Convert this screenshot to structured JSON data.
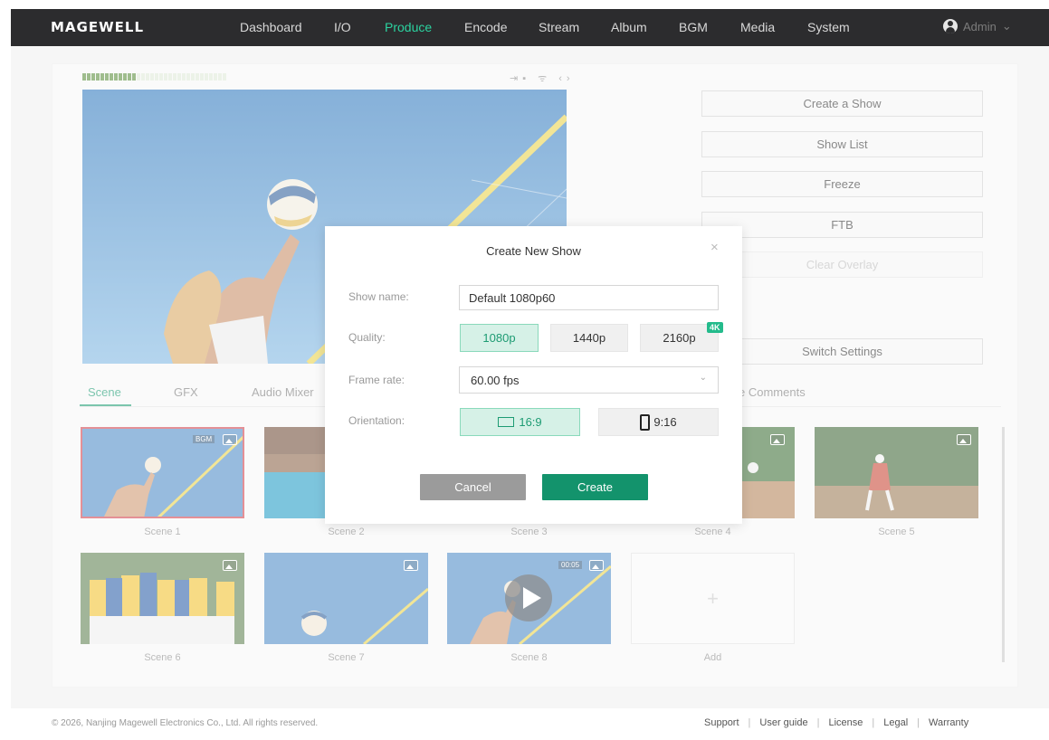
{
  "app": {
    "logo": "MAGEWELL"
  },
  "nav": {
    "items": [
      {
        "label": "Dashboard"
      },
      {
        "label": "I/O"
      },
      {
        "label": "Produce",
        "active": true
      },
      {
        "label": "Encode"
      },
      {
        "label": "Stream"
      },
      {
        "label": "Album"
      },
      {
        "label": "BGM"
      },
      {
        "label": "Media"
      },
      {
        "label": "System"
      }
    ],
    "user": "Admin",
    "user_chevron": "⌄"
  },
  "status_icons": "⇥▪ ᯤ ‹›",
  "side_buttons": {
    "create_show": "Create a Show",
    "show_list": "Show List",
    "freeze": "Freeze",
    "ftb": "FTB",
    "clear_overlay": "Clear Overlay",
    "switch_settings": "Switch Settings"
  },
  "tabs": {
    "scene": "Scene",
    "gfx": "GFX",
    "audio_mixer": "Audio Mixer",
    "live_comments": "e Comments"
  },
  "scenes": [
    {
      "label": "Scene 1",
      "badge": "BGM"
    },
    {
      "label": "Scene 2"
    },
    {
      "label": "Scene 3"
    },
    {
      "label": "Scene 4"
    },
    {
      "label": "Scene 5"
    },
    {
      "label": "Scene 6"
    },
    {
      "label": "Scene 7"
    },
    {
      "label": "Scene 8",
      "badge": "00:05"
    }
  ],
  "add_tile": {
    "icon": "+",
    "label": "Add"
  },
  "dialog": {
    "title": "Create New Show",
    "close": "×",
    "show_name_label": "Show name:",
    "show_name_value": "Default 1080p60",
    "quality_label": "Quality:",
    "quality_options": [
      "1080p",
      "1440p",
      "2160p"
    ],
    "quality_selected": "1080p",
    "quality_tag": "4K",
    "frame_rate_label": "Frame rate:",
    "frame_rate_value": "60.00 fps",
    "frame_rate_chevron": "⌄",
    "orientation_label": "Orientation:",
    "orientation_options": [
      "16:9",
      "9:16"
    ],
    "orientation_selected": "16:9",
    "cancel": "Cancel",
    "create": "Create"
  },
  "footer": {
    "copyright": "© 2026, Nanjing Magewell Electronics Co., Ltd. All rights reserved.",
    "links": [
      "Support",
      "User guide",
      "License",
      "Legal",
      "Warranty"
    ],
    "separator": "|"
  },
  "colors": {
    "accent": "#13936c",
    "nav_active": "#2bd3a0",
    "selected_scene": "#d1404a",
    "topbar": "#2c2c2e"
  }
}
